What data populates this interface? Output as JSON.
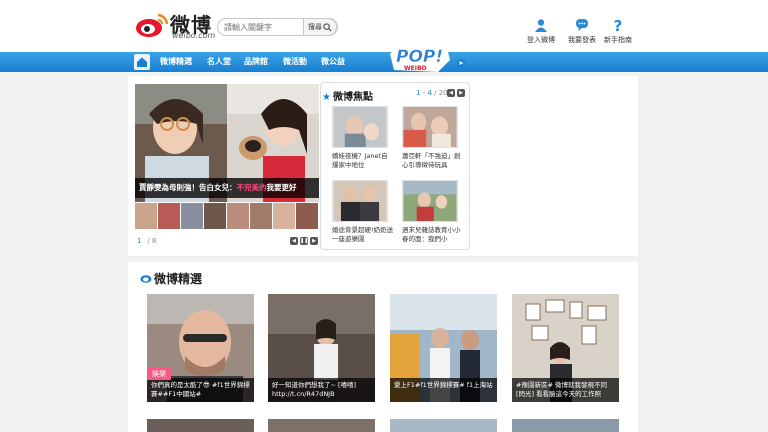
{
  "header": {
    "logo_text": "微博",
    "logo_sub": "weibo.com",
    "search_placeholder": "請輸入關鍵字",
    "search_button": "搜尋",
    "actions": [
      {
        "label": "登入微博",
        "icon": "user-icon"
      },
      {
        "label": "我要發表",
        "icon": "chat-bubble-icon"
      },
      {
        "label": "新手指南",
        "icon": "question-icon"
      }
    ]
  },
  "nav": {
    "items": [
      "微博精選",
      "名人堂",
      "品牌館",
      "微活動",
      "微公益"
    ],
    "pop_logo": "POP!",
    "pop_sub": "WEIBO"
  },
  "hero": {
    "caption_main": "賈靜雯為母則強！告白女兒：",
    "caption_highlight": "不完美的",
    "caption_tail": "我要更好",
    "page_current": "1",
    "page_sep": "/",
    "page_total": "8"
  },
  "focus": {
    "title": "微博焦點",
    "range": "1 - 4",
    "sep": "/",
    "total": "20",
    "items": [
      {
        "text": "嬌娃夜機？Janet自爆家中地位"
      },
      {
        "text": "蕭亞軒「不強迫」創心引導徵待玩具"
      },
      {
        "text": "婚途背景超硬!奶奶送一座遊樂園"
      },
      {
        "text": "週末兒雜誌教育小小春的面：我們小"
      }
    ]
  },
  "section": {
    "title": "微博精選"
  },
  "cards": [
    {
      "tag": "娛樂",
      "caption": "你們真的是太酷了😎 #f1世界錦標賽##F1中國站#"
    },
    {
      "tag": "",
      "caption": "好一知道你們想我了~ [嘻嘻] http://t.cn/R47dNJB"
    },
    {
      "tag": "",
      "caption": "愛上F1#f1世界錦標賽# f1上海站"
    },
    {
      "tag": "",
      "caption": "#豫園新區# 微博就我發現不同 [閃光] 看看臉這今天的工作照"
    }
  ],
  "colors": {
    "accent": "#1a7fd0",
    "tag": "#f45a84",
    "highlight": "#ff4a7d"
  }
}
